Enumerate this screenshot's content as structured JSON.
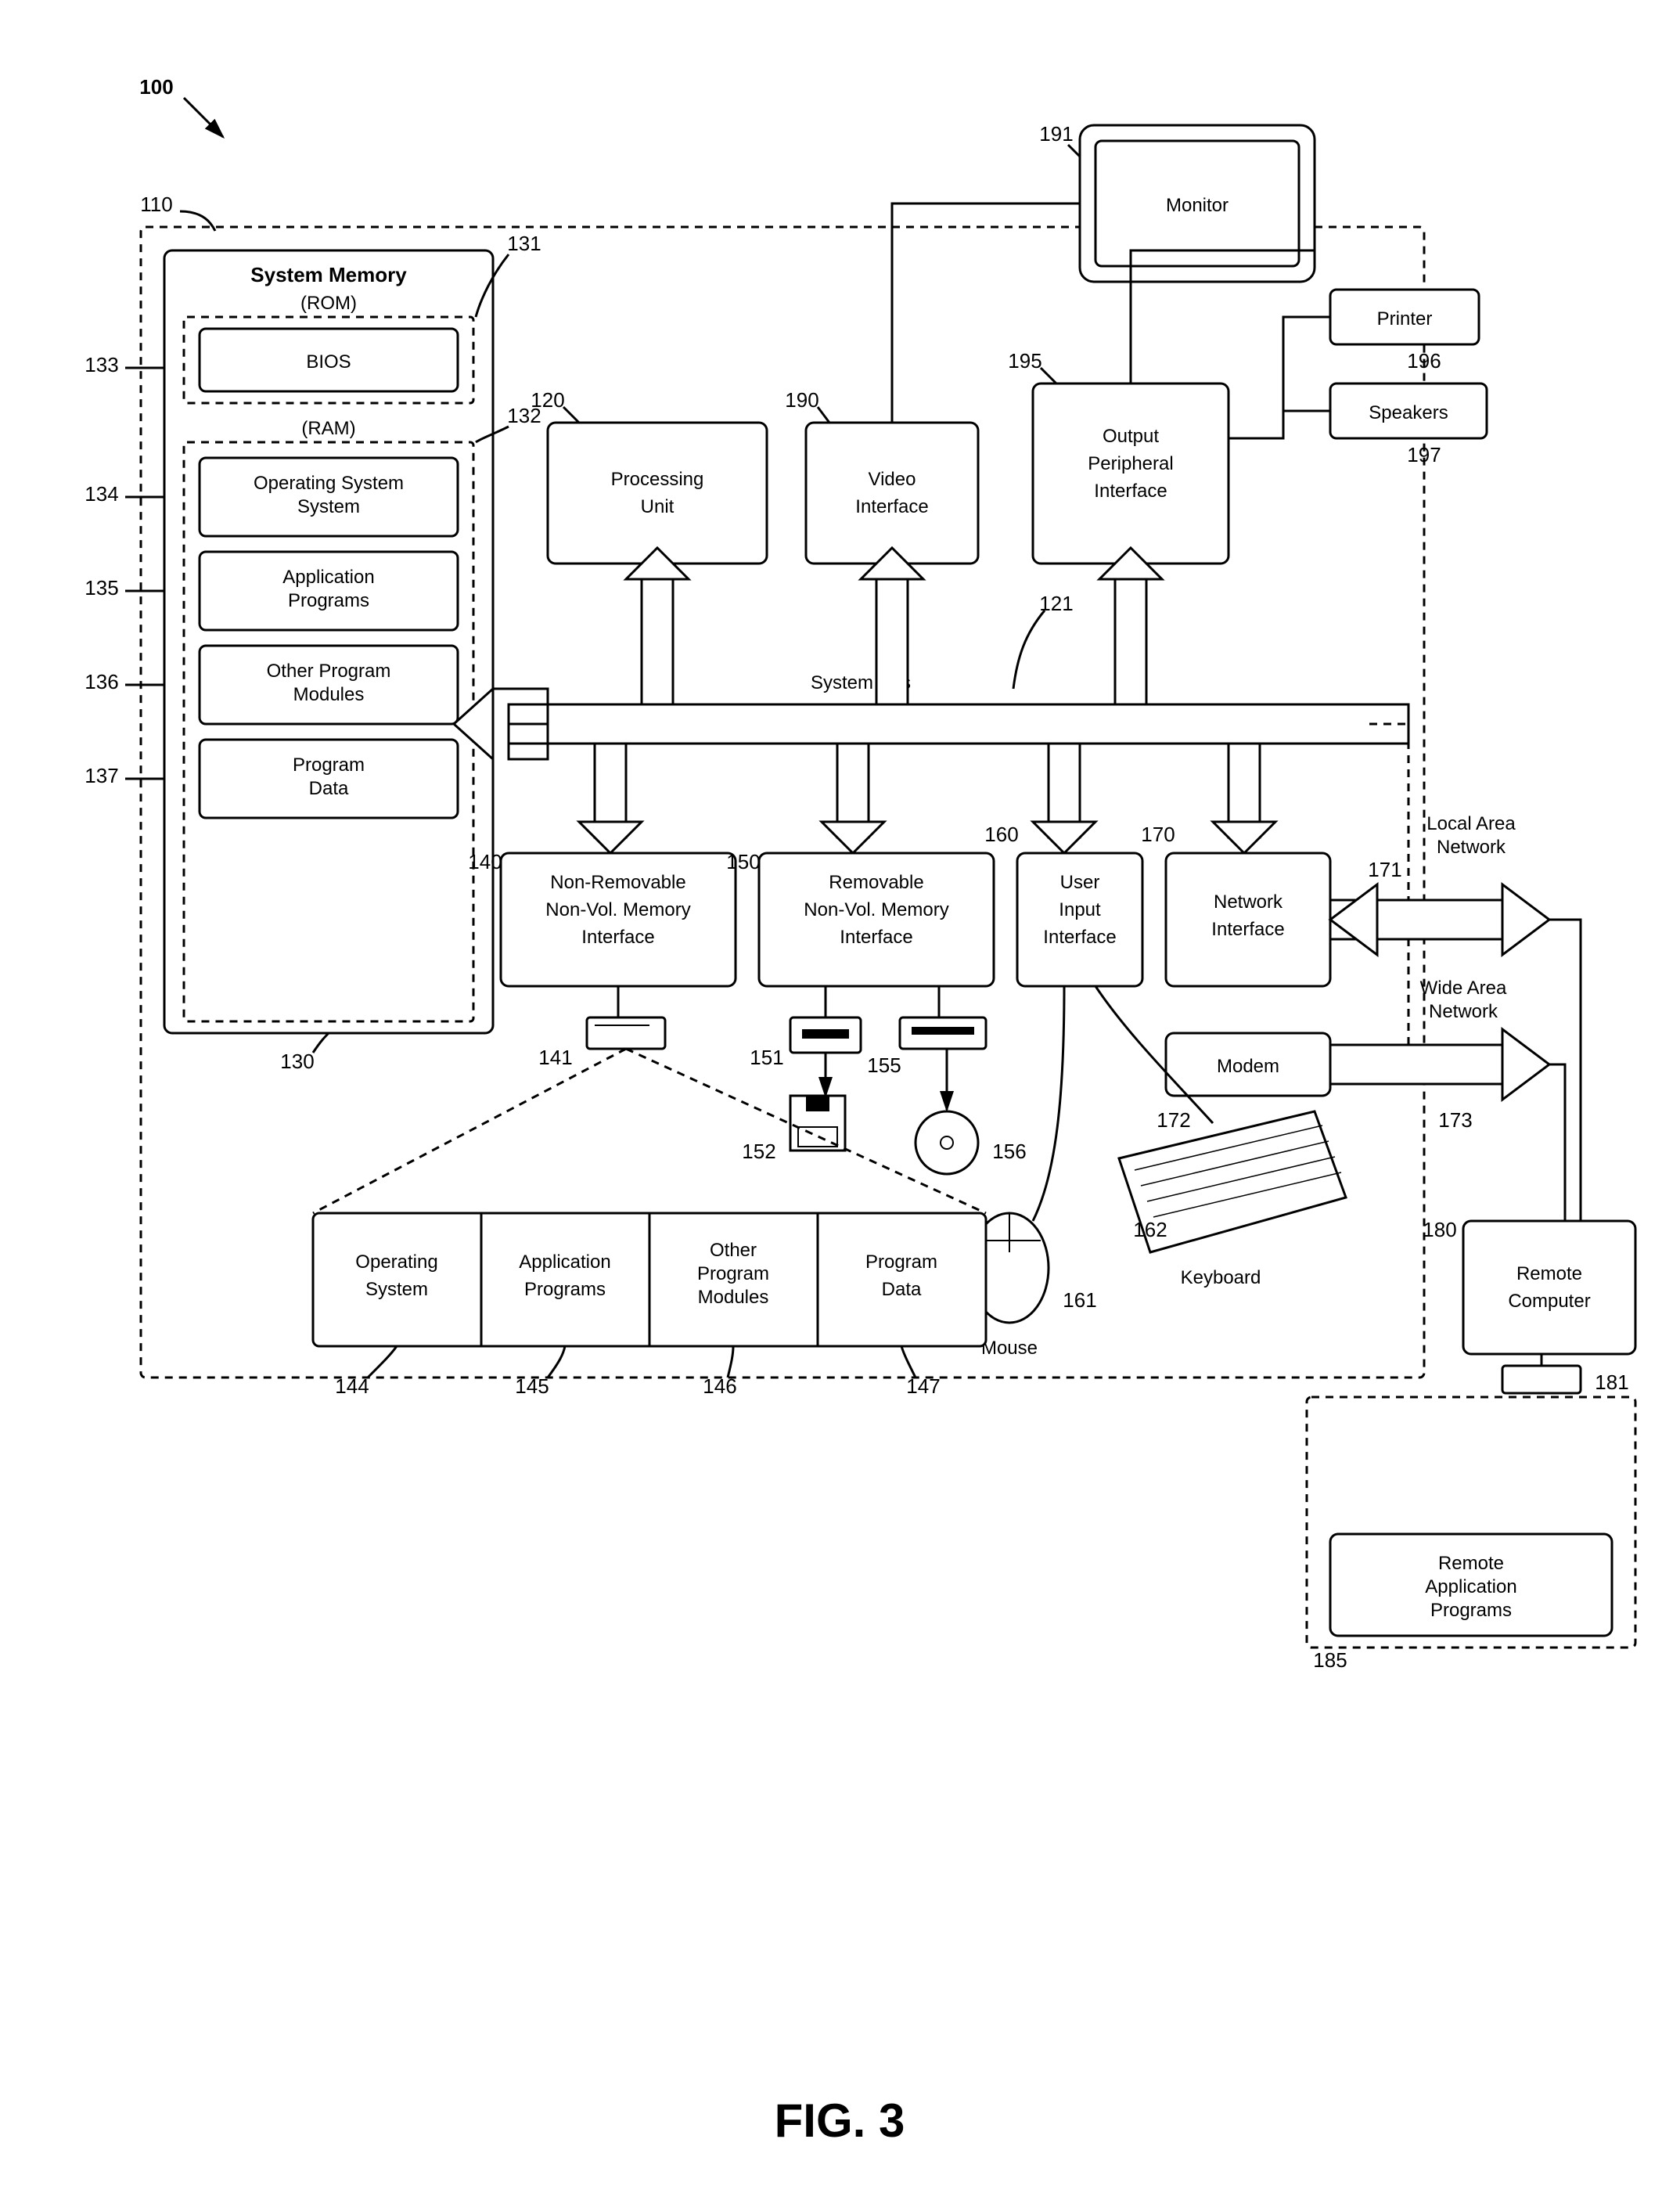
{
  "figure_label": "FIG. 3",
  "diagram_ref": "100",
  "computer_ref": "110",
  "system_memory": {
    "title": "System Memory",
    "rom_label": "(ROM)",
    "ram_label": "(RAM)",
    "rom_ref": "131",
    "ram_ref": "132",
    "sm_ref": "130",
    "bios": {
      "label": "BIOS",
      "ref": "133"
    },
    "os": {
      "label": "Operating System",
      "ref": "134"
    },
    "apps": {
      "label": "Application Programs",
      "ref": "135"
    },
    "mods": {
      "label": "Other Program Modules",
      "ref": "136"
    },
    "data": {
      "label": "Program Data",
      "ref": "137"
    }
  },
  "processing_unit": {
    "label": "Processing Unit",
    "ref": "120"
  },
  "video_interface": {
    "label": "Video Interface",
    "ref": "190"
  },
  "output_peripheral": {
    "label": "Output Peripheral Interface",
    "ref": "195"
  },
  "system_bus": {
    "label": "System Bus",
    "ref": "121"
  },
  "nonremovable": {
    "label1": "Non-Removable",
    "label2": "Non-Vol. Memory",
    "label3": "Interface",
    "ref": "140"
  },
  "removable": {
    "label1": "Removable",
    "label2": "Non-Vol. Memory",
    "label3": "Interface",
    "ref": "150"
  },
  "user_input": {
    "label1": "User",
    "label2": "Input",
    "label3": "Interface",
    "ref": "160"
  },
  "network_interface": {
    "label": "Network Interface",
    "ref": "170"
  },
  "modem": {
    "label": "Modem",
    "ref": "172"
  },
  "monitor": {
    "label": "Monitor",
    "ref": "191"
  },
  "printer": {
    "label": "Printer",
    "ref": "196"
  },
  "speakers": {
    "label": "Speakers",
    "ref": "197"
  },
  "lan": {
    "label": "Local Area Network",
    "ref": "171"
  },
  "wan": {
    "label": "Wide Area Network",
    "ref": "173"
  },
  "remote_computer": {
    "label": "Remote Computer",
    "ref": "180"
  },
  "remote_modem_ref": "181",
  "hdd": {
    "ref": "141"
  },
  "drive1_ref": "151",
  "floppy_ref": "152",
  "drive2_ref": "155",
  "disc_ref": "156",
  "mouse": {
    "label": "Mouse",
    "ref": "161"
  },
  "keyboard": {
    "label": "Keyboard",
    "ref": "162"
  },
  "hdd_contents": {
    "os": {
      "label": "Operating System",
      "ref": "144"
    },
    "apps": {
      "label": "Application Programs",
      "ref": "145"
    },
    "mods": {
      "label": "Other Program Modules",
      "ref": "146"
    },
    "data": {
      "label": "Program Data",
      "ref": "147"
    }
  },
  "remote_apps": {
    "label": "Remote Application Programs",
    "ref": "185"
  }
}
